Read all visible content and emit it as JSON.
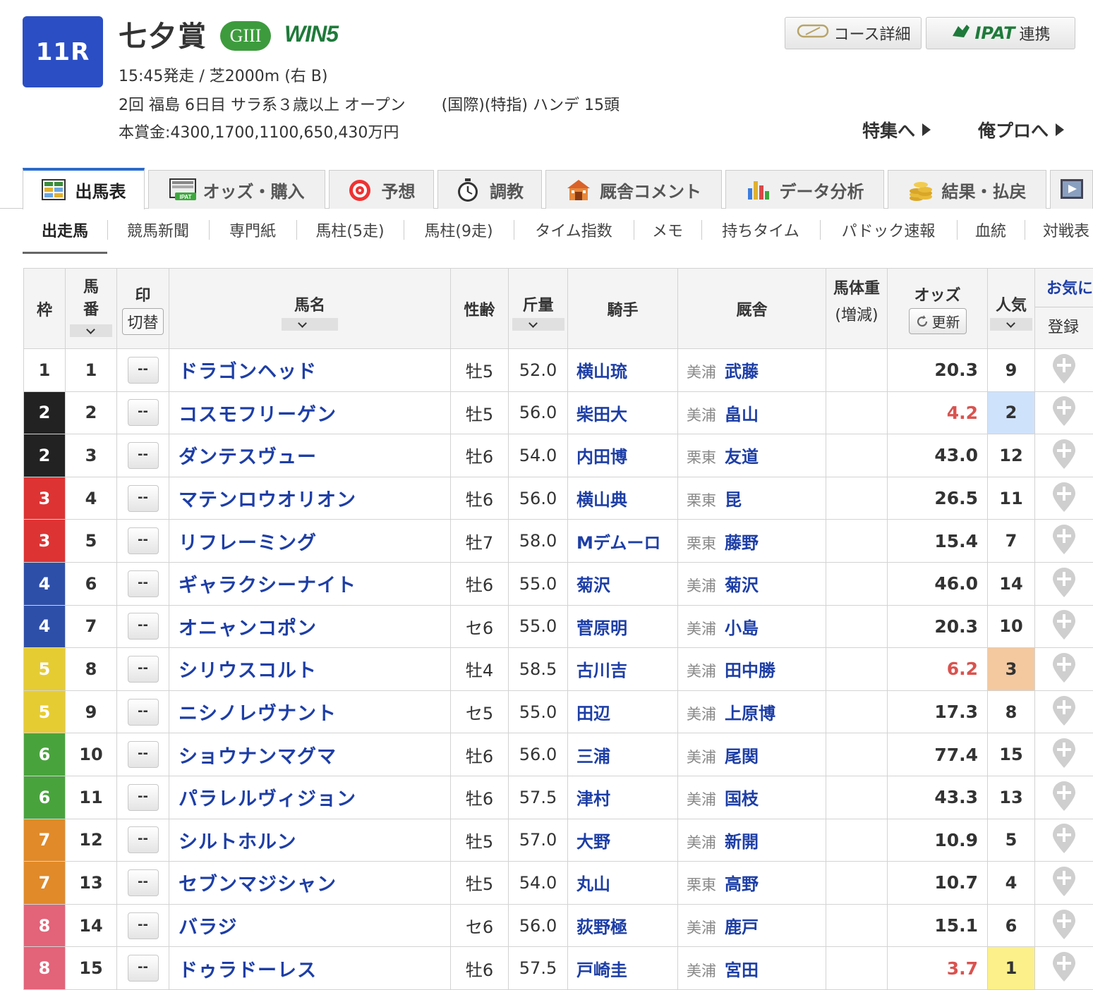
{
  "race": {
    "number": "11R",
    "name": "七夕賞",
    "grade": "GIII",
    "win5": "WIN5",
    "line1": "15:45発走 / 芝2000m (右 B)",
    "line2": "2回 福島 6日目 サラ系３歳以上 オープン　　 (国際)(特指) ハンデ 15頭",
    "line3": "本賞金:4300,1700,1100,650,430万円"
  },
  "header_buttons": {
    "course": "コース詳細",
    "ipat_logo": "IPAT",
    "ipat_label": "連携",
    "tokushu": "特集へ",
    "orepuro": "俺プロへ"
  },
  "tabs": [
    "出馬表",
    "オッズ・購入",
    "予想",
    "調教",
    "厩舎コメント",
    "データ分析",
    "結果・払戻"
  ],
  "subnav": [
    "出走馬",
    "競馬新聞",
    "専門紙",
    "馬柱(5走)",
    "馬柱(9走)",
    "タイム指数",
    "メモ",
    "持ちタイム",
    "パドック速報",
    "血統",
    "対戦表"
  ],
  "table": {
    "headers": {
      "waku": "枠",
      "umaban": "馬番",
      "mark": "印",
      "mark_toggle": "切替",
      "horse": "馬名",
      "sexage": "性齢",
      "kinryo": "斤量",
      "jockey": "騎手",
      "trainer": "厩舎",
      "weight": "馬体重",
      "weight_diff": "(増減)",
      "odds": "オッズ",
      "odds_refresh": "更新",
      "ninki": "人気",
      "fav": "お気に",
      "fav_reg": "登録"
    },
    "mark_placeholder": "--",
    "rows": [
      {
        "waku": "1",
        "umaban": "1",
        "horse": "ドラゴンヘッド",
        "sexage": "牡5",
        "kinryo": "52.0",
        "jockey": "横山琉",
        "area": "美浦",
        "trainer": "武藤",
        "odds": "20.3",
        "ninki": "9"
      },
      {
        "waku": "2",
        "umaban": "2",
        "horse": "コスモフリーゲン",
        "sexage": "牡5",
        "kinryo": "56.0",
        "jockey": "柴田大",
        "area": "美浦",
        "trainer": "畠山",
        "odds": "4.2",
        "ninki": "2"
      },
      {
        "waku": "2",
        "umaban": "3",
        "horse": "ダンテスヴュー",
        "sexage": "牡6",
        "kinryo": "54.0",
        "jockey": "内田博",
        "area": "栗東",
        "trainer": "友道",
        "odds": "43.0",
        "ninki": "12"
      },
      {
        "waku": "3",
        "umaban": "4",
        "horse": "マテンロウオリオン",
        "sexage": "牡6",
        "kinryo": "56.0",
        "jockey": "横山典",
        "area": "栗東",
        "trainer": "昆",
        "odds": "26.5",
        "ninki": "11"
      },
      {
        "waku": "3",
        "umaban": "5",
        "horse": "リフレーミング",
        "sexage": "牡7",
        "kinryo": "58.0",
        "jockey": "Mデムーロ",
        "area": "栗東",
        "trainer": "藤野",
        "odds": "15.4",
        "ninki": "7"
      },
      {
        "waku": "4",
        "umaban": "6",
        "horse": "ギャラクシーナイト",
        "sexage": "牡6",
        "kinryo": "55.0",
        "jockey": "菊沢",
        "area": "美浦",
        "trainer": "菊沢",
        "odds": "46.0",
        "ninki": "14"
      },
      {
        "waku": "4",
        "umaban": "7",
        "horse": "オニャンコポン",
        "sexage": "セ6",
        "kinryo": "55.0",
        "jockey": "菅原明",
        "area": "美浦",
        "trainer": "小島",
        "odds": "20.3",
        "ninki": "10"
      },
      {
        "waku": "5",
        "umaban": "8",
        "horse": "シリウスコルト",
        "sexage": "牡4",
        "kinryo": "58.5",
        "jockey": "古川吉",
        "area": "美浦",
        "trainer": "田中勝",
        "odds": "6.2",
        "ninki": "3"
      },
      {
        "waku": "5",
        "umaban": "9",
        "horse": "ニシノレヴナント",
        "sexage": "セ5",
        "kinryo": "55.0",
        "jockey": "田辺",
        "area": "美浦",
        "trainer": "上原博",
        "odds": "17.3",
        "ninki": "8"
      },
      {
        "waku": "6",
        "umaban": "10",
        "horse": "ショウナンマグマ",
        "sexage": "牡6",
        "kinryo": "56.0",
        "jockey": "三浦",
        "area": "美浦",
        "trainer": "尾関",
        "odds": "77.4",
        "ninki": "15"
      },
      {
        "waku": "6",
        "umaban": "11",
        "horse": "パラレルヴィジョン",
        "sexage": "牡6",
        "kinryo": "57.5",
        "jockey": "津村",
        "area": "美浦",
        "trainer": "国枝",
        "odds": "43.3",
        "ninki": "13"
      },
      {
        "waku": "7",
        "umaban": "12",
        "horse": "シルトホルン",
        "sexage": "牡5",
        "kinryo": "57.0",
        "jockey": "大野",
        "area": "美浦",
        "trainer": "新開",
        "odds": "10.9",
        "ninki": "5"
      },
      {
        "waku": "7",
        "umaban": "13",
        "horse": "セブンマジシャン",
        "sexage": "牡5",
        "kinryo": "54.0",
        "jockey": "丸山",
        "area": "栗東",
        "trainer": "高野",
        "odds": "10.7",
        "ninki": "4"
      },
      {
        "waku": "8",
        "umaban": "14",
        "horse": "バラジ",
        "sexage": "セ6",
        "kinryo": "56.0",
        "jockey": "荻野極",
        "area": "美浦",
        "trainer": "鹿戸",
        "odds": "15.1",
        "ninki": "6"
      },
      {
        "waku": "8",
        "umaban": "15",
        "horse": "ドゥラドーレス",
        "sexage": "牡6",
        "kinryo": "57.5",
        "jockey": "戸崎圭",
        "area": "美浦",
        "trainer": "宮田",
        "odds": "3.7",
        "ninki": "1"
      }
    ]
  },
  "colors": {
    "race_badge": "#2b4ec4",
    "grade_green": "#3d9b3d",
    "link_blue": "#1d3ea6",
    "odds_hot": "#d9534f",
    "waku": {
      "1": "#ffffff",
      "2": "#222222",
      "3": "#dd3333",
      "4": "#2e4fa8",
      "5": "#e5cc33",
      "6": "#49a33d",
      "7": "#e08a2a",
      "8": "#e36379"
    },
    "ninki_1": "#fbf08a",
    "ninki_2": "#cfe2fb",
    "ninki_3": "#f4c9a0"
  }
}
